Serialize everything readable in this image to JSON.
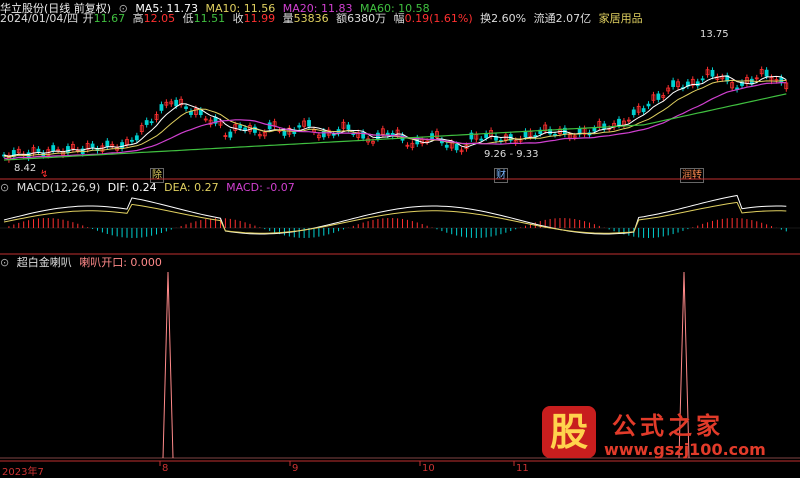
{
  "header": {
    "stock_name": "华立股份(日线 前复权)",
    "date": "2024/01/04/四",
    "open_label": "开",
    "open": "11.67",
    "high_label": "高",
    "high": "12.05",
    "low_label": "低",
    "low": "11.51",
    "close_label": "收",
    "close": "11.99",
    "volume_label": "量",
    "volume": "53836",
    "amount_label": "额",
    "amount": "6380万",
    "change_label": "幅",
    "change": "0.19(1.61%)",
    "turnover": "换2.60%",
    "float_cap": "流通2.07亿",
    "sector": "家居用品"
  },
  "ma": {
    "ma5_label": "MA5: 11.73",
    "ma10_label": "MA10: 11.56",
    "ma20_label": "MA20: 11.83",
    "ma60_label": "MA60: 10.58"
  },
  "price_annotations": {
    "max": "13.75",
    "min": "8.42",
    "range": "9.26 - 9.33"
  },
  "event_markers": [
    "↯",
    "除",
    "财",
    "润转"
  ],
  "macd": {
    "title": "MACD(12,26,9)",
    "dif": "DIF: 0.24",
    "dea": "DEA: 0.27",
    "macd": "MACD: -0.07"
  },
  "indicator": {
    "title": "超白金喇叭",
    "field": "喇叭开口: 0.000"
  },
  "x_axis": [
    "2023年7",
    "8",
    "9",
    "10",
    "11"
  ],
  "watermark": {
    "big_char": "股",
    "name": "公式之家",
    "url": "www.gszj100.com"
  },
  "colors": {
    "ma5": "#ffffff",
    "ma10": "#e0d060",
    "ma20": "#d040d0",
    "ma60": "#40c040",
    "up": "#ff3030",
    "down": "#00d0d0",
    "axis": "#c03030"
  }
}
